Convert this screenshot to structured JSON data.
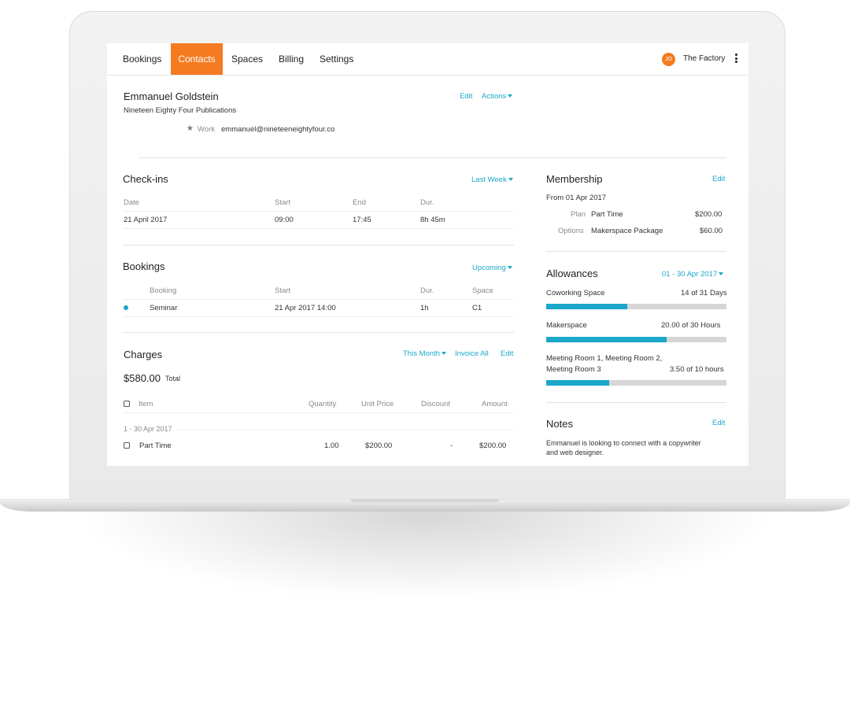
{
  "nav": {
    "tabs": [
      {
        "label": "Bookings"
      },
      {
        "label": "Contacts",
        "active": true
      },
      {
        "label": "Spaces"
      },
      {
        "label": "Billing"
      },
      {
        "label": "Settings"
      }
    ],
    "avatar_initials": "JO",
    "org_name": "The Factory"
  },
  "contact": {
    "name": "Emmanuel Goldstein",
    "company": "Nineteen Eighty Four Publications",
    "email_type": "Work",
    "email": "emmanuel@nineteeneightyfour.co",
    "edit_label": "Edit",
    "actions_label": "Actions"
  },
  "checkins": {
    "title": "Check-ins",
    "filter": "Last Week",
    "columns": [
      "Date",
      "Start",
      "End",
      "Dur."
    ],
    "rows": [
      {
        "date": "21 April 2017",
        "start": "09:00",
        "end": "17:45",
        "dur": "8h 45m"
      }
    ]
  },
  "bookings": {
    "title": "Bookings",
    "filter": "Upcoming",
    "columns": [
      "Booking",
      "Start",
      "Dur.",
      "Space"
    ],
    "rows": [
      {
        "booking": "Seminar",
        "start": "21 Apr 2017 14:00",
        "dur": "1h",
        "space": "C1"
      }
    ]
  },
  "charges": {
    "title": "Charges",
    "filter": "This Month",
    "invoice_all_label": "Invoice All",
    "edit_label": "Edit",
    "total_amount": "$580.00",
    "total_label": "Total",
    "columns": [
      "Item",
      "Quantity",
      "Unit Price",
      "Discount",
      "Amount"
    ],
    "group_label": "1 - 30 Apr 2017",
    "rows": [
      {
        "item": "Part Time",
        "quantity": "1.00",
        "unit_price": "$200.00",
        "discount": "-",
        "amount": "$200.00"
      }
    ]
  },
  "membership": {
    "title": "Membership",
    "edit_label": "Edit",
    "from": "From 01 Apr 2017",
    "plan_label": "Plan",
    "plan_name": "Part Time",
    "plan_price": "$200.00",
    "options_label": "Options",
    "options_name": "Makerspace Package",
    "options_price": "$60.00"
  },
  "allowances": {
    "title": "Allowances",
    "period": "01 - 30 Apr 2017",
    "items": [
      {
        "name": "Coworking Space",
        "usage": "14 of 31 Days",
        "fraction": 0.45
      },
      {
        "name": "Makerspace",
        "usage": "20.00 of 30 Hours",
        "fraction": 0.667
      },
      {
        "name_line1": "Meeting Room 1, Meeting Room 2,",
        "name_line2": "Meeting Room 3",
        "usage": "3.50 of 10 hours",
        "fraction": 0.35
      }
    ]
  },
  "notes": {
    "title": "Notes",
    "edit_label": "Edit",
    "text_line1": "Emmanuel is looking to connect with a copywriter",
    "text_line2": "and web designer."
  },
  "colors": {
    "accent": "#f47b20",
    "link": "#1aa7c9",
    "bar_track": "#d6d6d6"
  }
}
